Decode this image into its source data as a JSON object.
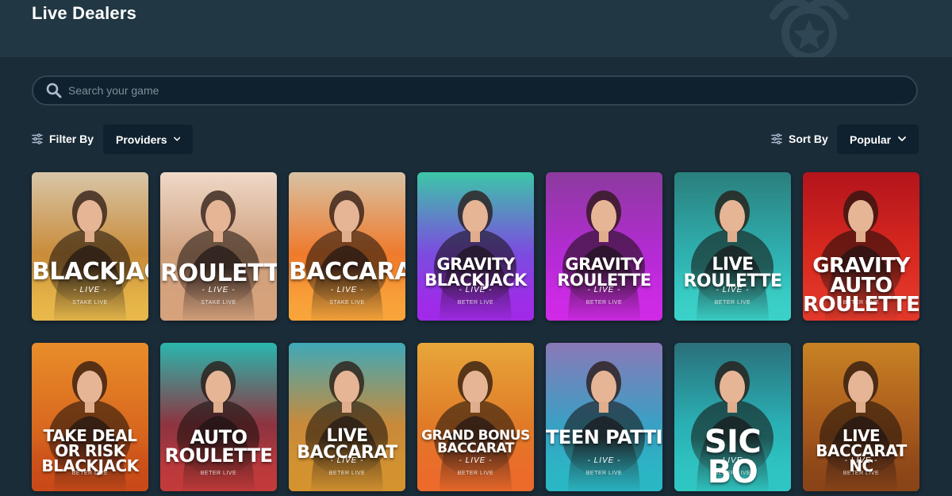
{
  "header": {
    "title": "Live Dealers"
  },
  "search": {
    "placeholder": "Search your game"
  },
  "filter": {
    "label": "Filter By",
    "dropdown": "Providers"
  },
  "sort": {
    "label": "Sort By",
    "dropdown": "Popular"
  },
  "games": [
    {
      "title": "BLACKJACK",
      "tag": "- LIVE -",
      "provider": "STAKE LIVE",
      "colors": [
        "#d8c6a8",
        "#c98c3a",
        "#e8b84a"
      ]
    },
    {
      "title": "ROULETTE",
      "tag": "- LIVE -",
      "provider": "STAKE LIVE",
      "colors": [
        "#efd9c8",
        "#cf9f7c",
        "#d6a27c"
      ]
    },
    {
      "title": "BACCARAT",
      "tag": "- LIVE -",
      "provider": "STAKE LIVE",
      "colors": [
        "#d8c2a4",
        "#ef7a2c",
        "#f9a53a"
      ]
    },
    {
      "title": "GRAVITY BLACKJACK",
      "tag": "- LIVE -",
      "provider": "BETER LIVE",
      "colors": [
        "#3cc7a7",
        "#7c4be0",
        "#a02ae8"
      ]
    },
    {
      "title": "GRAVITY ROULETTE",
      "tag": "- LIVE -",
      "provider": "BETER LIVE",
      "colors": [
        "#8c3a9e",
        "#b42bd4",
        "#cf2ae6"
      ]
    },
    {
      "title": "LIVE ROULETTE",
      "tag": "- LIVE -",
      "provider": "BETER LIVE",
      "colors": [
        "#2a7f7c",
        "#2fb0b0",
        "#3ad1c8"
      ]
    },
    {
      "title": "GRAVITY AUTO ROULETTE",
      "tag": "",
      "provider": "BETER LIVE",
      "colors": [
        "#b3141c",
        "#d8291f",
        "#e2382a"
      ]
    },
    {
      "title": "TAKE DEAL OR RISK BLACKJACK",
      "tag": "",
      "provider": "BETER LIVE",
      "colors": [
        "#e98d2a",
        "#d96a1f",
        "#c94a18"
      ]
    },
    {
      "title": "AUTO ROULETTE",
      "tag": "",
      "provider": "BETER LIVE",
      "colors": [
        "#2ab7ae",
        "#8e3440",
        "#c23a3a"
      ]
    },
    {
      "title": "LIVE BACCARAT",
      "tag": "- LIVE -",
      "provider": "BETER LIVE",
      "colors": [
        "#3fa9b8",
        "#c98a3a",
        "#d4932f"
      ]
    },
    {
      "title": "GRAND BONUS BACCARAT",
      "tag": "- LIVE -",
      "provider": "BETER LIVE",
      "colors": [
        "#e8a63a",
        "#e07b28",
        "#ec6a2a"
      ]
    },
    {
      "title": "TEEN PATTI",
      "tag": "- LIVE -",
      "provider": "BETER LIVE",
      "colors": [
        "#8a78b8",
        "#3aa0c4",
        "#2ab7c4"
      ]
    },
    {
      "title": "SIC BO",
      "tag": "- LIVE -",
      "provider": "BETER LIVE",
      "colors": [
        "#2a6f7a",
        "#2ab0b4",
        "#2fc6c2"
      ]
    },
    {
      "title": "LIVE BACCARAT NC",
      "tag": "- LIVE -",
      "provider": "BETER LIVE",
      "colors": [
        "#c98224",
        "#a85a1c",
        "#8a4418"
      ]
    }
  ]
}
